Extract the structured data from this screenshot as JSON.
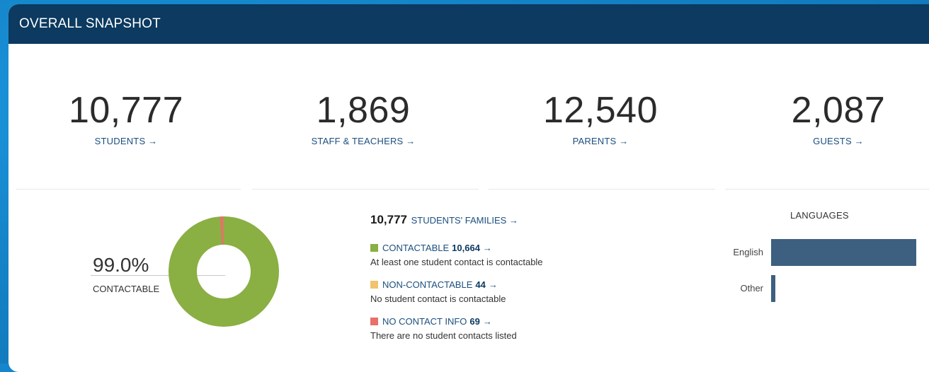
{
  "header": {
    "title": "OVERALL SNAPSHOT"
  },
  "stats": [
    {
      "value": "10,777",
      "label": "STUDENTS →"
    },
    {
      "value": "1,869",
      "label": "STAFF & TEACHERS →"
    },
    {
      "value": "12,540",
      "label": "PARENTS →"
    },
    {
      "value": "2,087",
      "label": "GUESTS →"
    }
  ],
  "contactable": {
    "percent": "99.0%",
    "label": "CONTACTABLE",
    "share": 0.99
  },
  "families": {
    "count": "10,777",
    "label": "STUDENTS' FAMILIES →",
    "categories": [
      {
        "name": "CONTACTABLE",
        "count": "10,664",
        "arrow": "→",
        "desc": "At least one student contact is contactable",
        "color": "#8aaf43"
      },
      {
        "name": "NON-CONTACTABLE",
        "count": "44",
        "arrow": "→",
        "desc": "No student contact is contactable",
        "color": "#f0c36d"
      },
      {
        "name": "NO CONTACT INFO",
        "count": "69",
        "arrow": "→",
        "desc": "There are no student contacts listed",
        "color": "#e8706a"
      }
    ]
  },
  "languages": {
    "title": "LANGUAGES",
    "items": [
      {
        "name": "English",
        "share": 0.985
      },
      {
        "name": "Other",
        "share": 0.015
      }
    ]
  },
  "colors": {
    "header": "#0c3a60",
    "link": "#1c4f7f",
    "bar": "#3d6080"
  }
}
